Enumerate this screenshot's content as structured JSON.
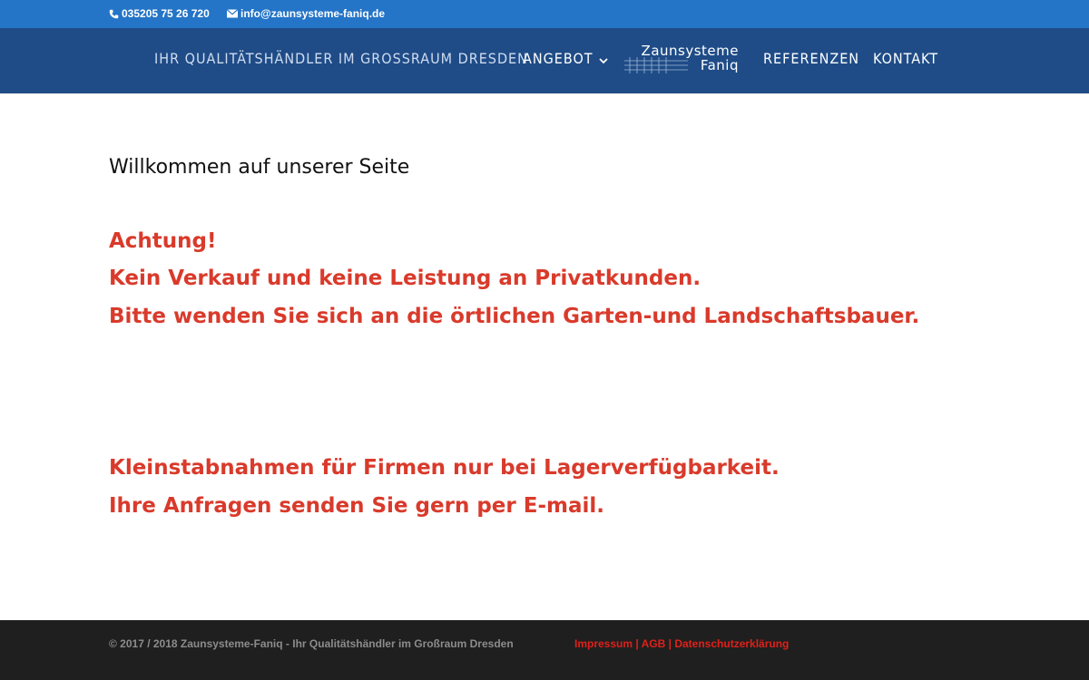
{
  "topbar": {
    "phone": "035205 75 26 720",
    "email": "info@zaunsysteme-faniq.de",
    "phone_icon": "phone-icon",
    "email_icon": "envelope-icon"
  },
  "nav": {
    "tagline": "IHR QUALITÄTSHÄNDLER IM GROSSRAUM DRESDEN",
    "angebot": "ANGEBOT",
    "referenzen": "REFERENZEN",
    "kontakt": "KONTAKT",
    "logo_line1": "Zaunsysteme",
    "logo_line2": "Faniq"
  },
  "main": {
    "welcome": "Willkommen auf unserer Seite",
    "warning_1": "Achtung!",
    "warning_2": "Kein Verkauf und keine Leistung an Privatkunden.",
    "warning_3": "Bitte wenden Sie sich an die örtlichen Garten-und Landschaftsbauer.",
    "notice_1": "Kleinstabnahmen für Firmen nur bei Lagerverfügbarkeit.",
    "notice_2": "Ihre Anfragen senden Sie gern per E-mail."
  },
  "footer": {
    "copyright": "© 2017 / 2018 Zaunsysteme-Faniq - Ihr Qualitätshändler im Großraum Dresden",
    "impressum": "Impressum",
    "agb": "AGB",
    "datenschutz": "Datenschutzerklärung",
    "separator": "|"
  },
  "colors": {
    "topbar": "#2474c7",
    "navbar": "#1f4c87",
    "warning_red": "#d93a2b",
    "footer_bg": "#1f1f1f",
    "footer_link": "#e0201a"
  }
}
